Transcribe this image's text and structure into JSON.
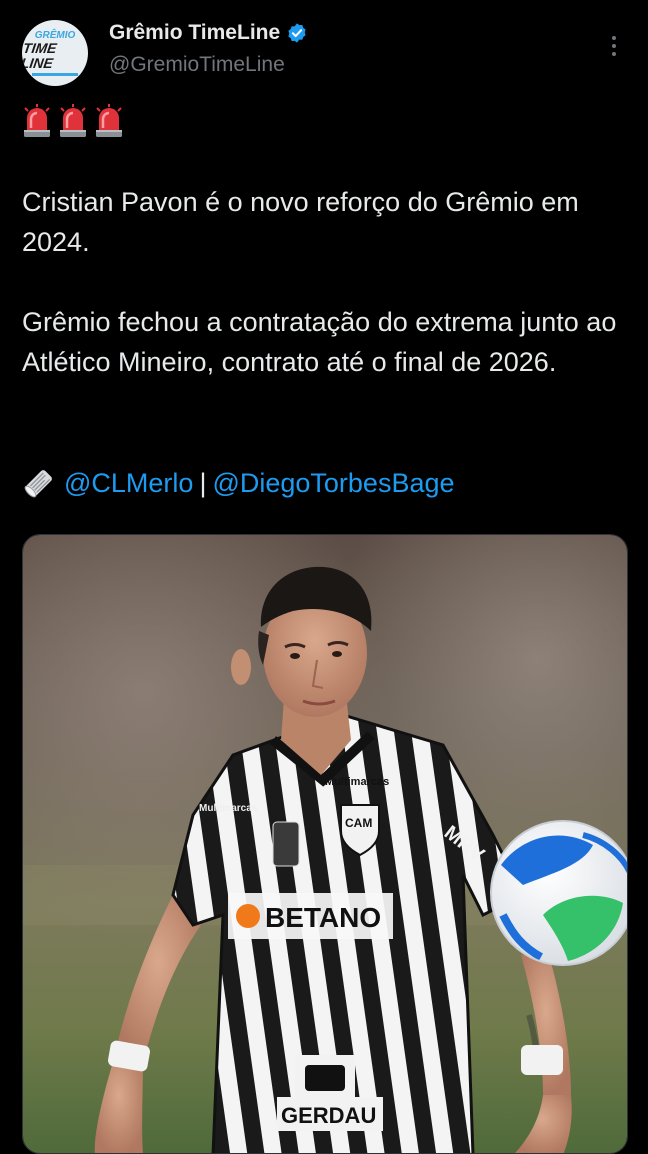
{
  "author": {
    "display_name": "Grêmio TimeLine",
    "handle": "@GremioTimeLine",
    "verified": true,
    "avatar_logo": {
      "top": "GRÊMIO",
      "bottom": "TIME LINE"
    }
  },
  "icons": {
    "siren": "police-siren-icon",
    "newspaper": "rolled-newspaper-icon",
    "verified": "verified-badge-icon",
    "more": "more-options-icon"
  },
  "tweet": {
    "paragraph1": "Cristian Pavon é o novo reforço do Grêmio em 2024.",
    "paragraph2": "Grêmio fechou a contratação do extrema junto ao Atlético Mineiro, contrato até o final de 2026.",
    "credits": {
      "mention1": "@CLMerlo",
      "separator": "|",
      "mention2": "@DiegoTorbesBage"
    }
  },
  "media": {
    "jersey_sponsor": "BETANO",
    "jersey_logo": "Multimarcas",
    "sleeve_sponsor": "MRV",
    "shorts_sponsor": "GERDAU",
    "crest_text": "CAM"
  },
  "colors": {
    "background": "#000000",
    "text": "#e7e9ea",
    "secondary_text": "#71767b",
    "link": "#1d9bf0",
    "verified": "#1d9bf0"
  }
}
